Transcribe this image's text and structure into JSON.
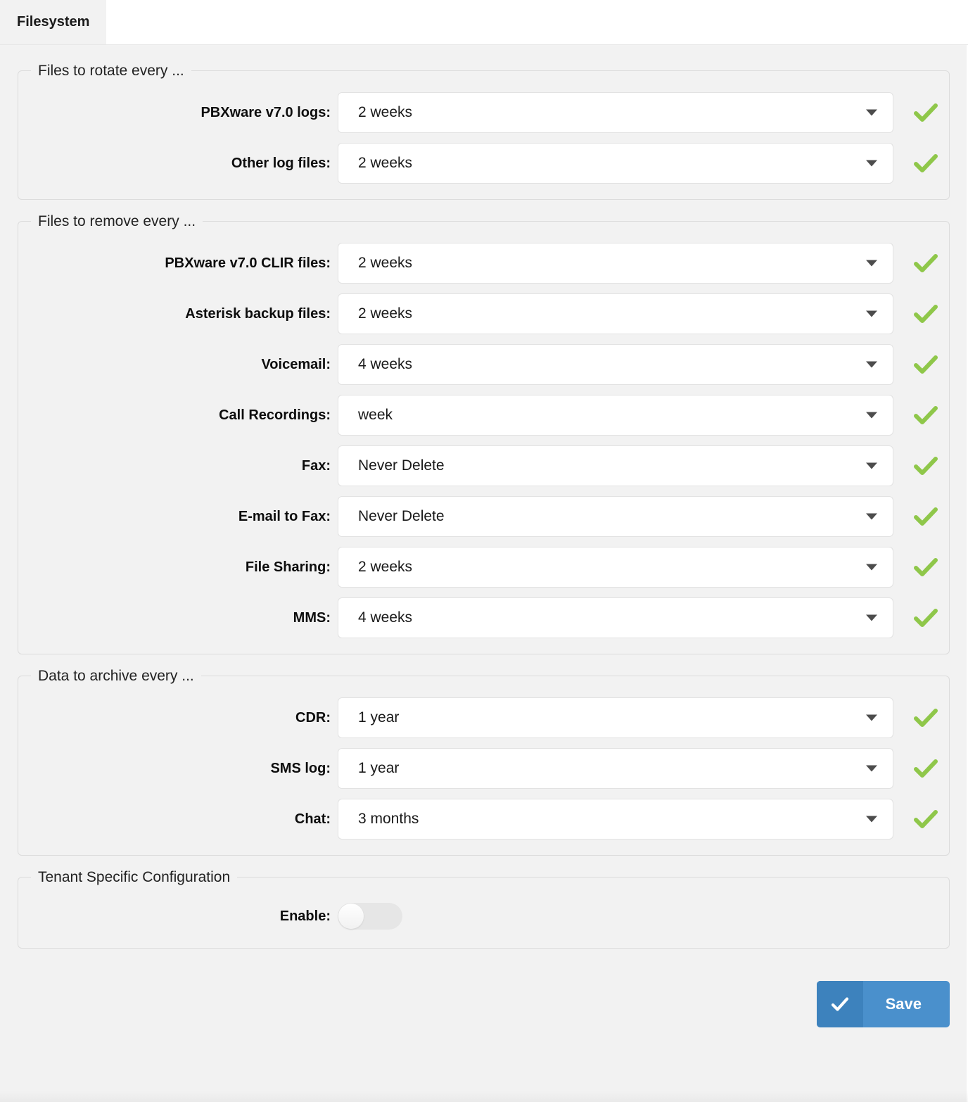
{
  "window": {
    "title": "Filesystem"
  },
  "tabs": [
    {
      "label": "Filesystem",
      "active": true
    }
  ],
  "colors": {
    "accent_blue": "#4a90cc",
    "accent_blue_dark": "#3d82bd",
    "check_green": "#8fc74a",
    "panel_bg": "#f2f2f2",
    "field_bg": "#ffffff",
    "border": "#dcdcdc"
  },
  "groups": [
    {
      "legend": "Files to rotate every ...",
      "rows": [
        {
          "label": "PBXware v7.0 logs:",
          "value": "2 weeks",
          "status": "valid"
        },
        {
          "label": "Other log files:",
          "value": "2 weeks",
          "status": "valid"
        }
      ]
    },
    {
      "legend": "Files to remove every ...",
      "rows": [
        {
          "label": "PBXware v7.0 CLIR files:",
          "value": "2 weeks",
          "status": "valid"
        },
        {
          "label": "Asterisk backup files:",
          "value": "2 weeks",
          "status": "valid"
        },
        {
          "label": "Voicemail:",
          "value": "4 weeks",
          "status": "valid"
        },
        {
          "label": "Call Recordings:",
          "value": "week",
          "status": "valid"
        },
        {
          "label": "Fax:",
          "value": "Never Delete",
          "status": "valid"
        },
        {
          "label": "E-mail to Fax:",
          "value": "Never Delete",
          "status": "valid"
        },
        {
          "label": "File Sharing:",
          "value": "2 weeks",
          "status": "valid"
        },
        {
          "label": "MMS:",
          "value": "4 weeks",
          "status": "valid"
        }
      ]
    },
    {
      "legend": "Data to archive every ...",
      "rows": [
        {
          "label": "CDR:",
          "value": "1 year",
          "status": "valid"
        },
        {
          "label": "SMS log:",
          "value": "1 year",
          "status": "valid"
        },
        {
          "label": "Chat:",
          "value": "3 months",
          "status": "valid"
        }
      ]
    }
  ],
  "tenant_group": {
    "legend": "Tenant Specific Configuration",
    "enable_label": "Enable:",
    "enable_value": "off"
  },
  "footer": {
    "save_label": "Save",
    "save_icon": "check-icon"
  }
}
